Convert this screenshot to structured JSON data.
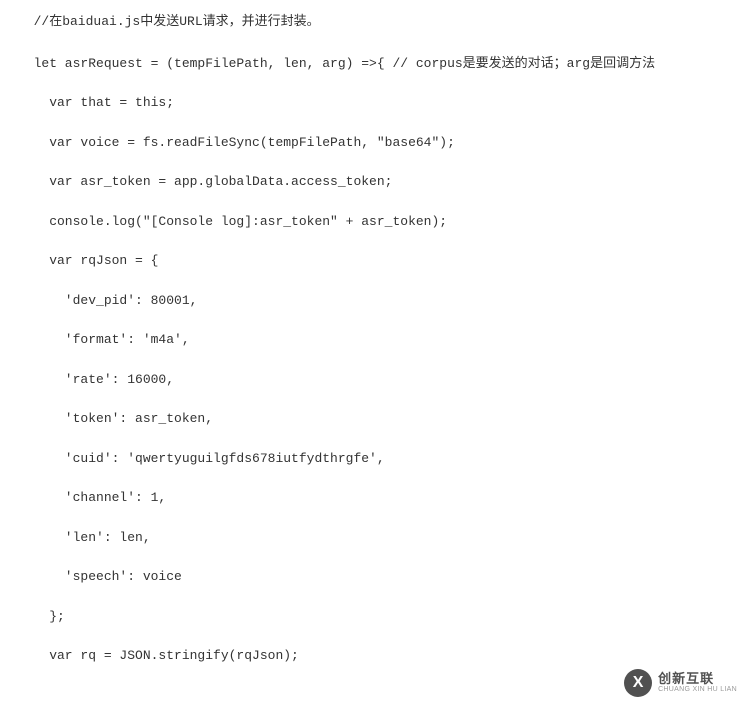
{
  "code": {
    "lines": [
      "  //在baiduai.js中发送URL请求，并进行封装。",
      "  let asrRequest = (tempFilePath, len, arg) =>{ // corpus是要发送的对话；arg是回调方法",
      "    var that = this;",
      "    var voice = fs.readFileSync(tempFilePath, \"base64\");",
      "    var asr_token = app.globalData.access_token;",
      "    console.log(\"[Console log]:asr_token\" + asr_token);",
      "    var rqJson = {",
      "      'dev_pid': 80001,",
      "      'format': 'm4a',",
      "      'rate': 16000,",
      "      'token': asr_token,",
      "      'cuid': 'qwertyuguilgfds678iutfydthrgfe',",
      "      'channel': 1,",
      "      'len': len,",
      "      'speech': voice",
      "    };",
      "    var rq = JSON.stringify(rqJson);"
    ]
  },
  "watermark": {
    "icon_letter": "X",
    "cn": "创新互联",
    "en": "CHUANG XIN HU LIAN"
  }
}
